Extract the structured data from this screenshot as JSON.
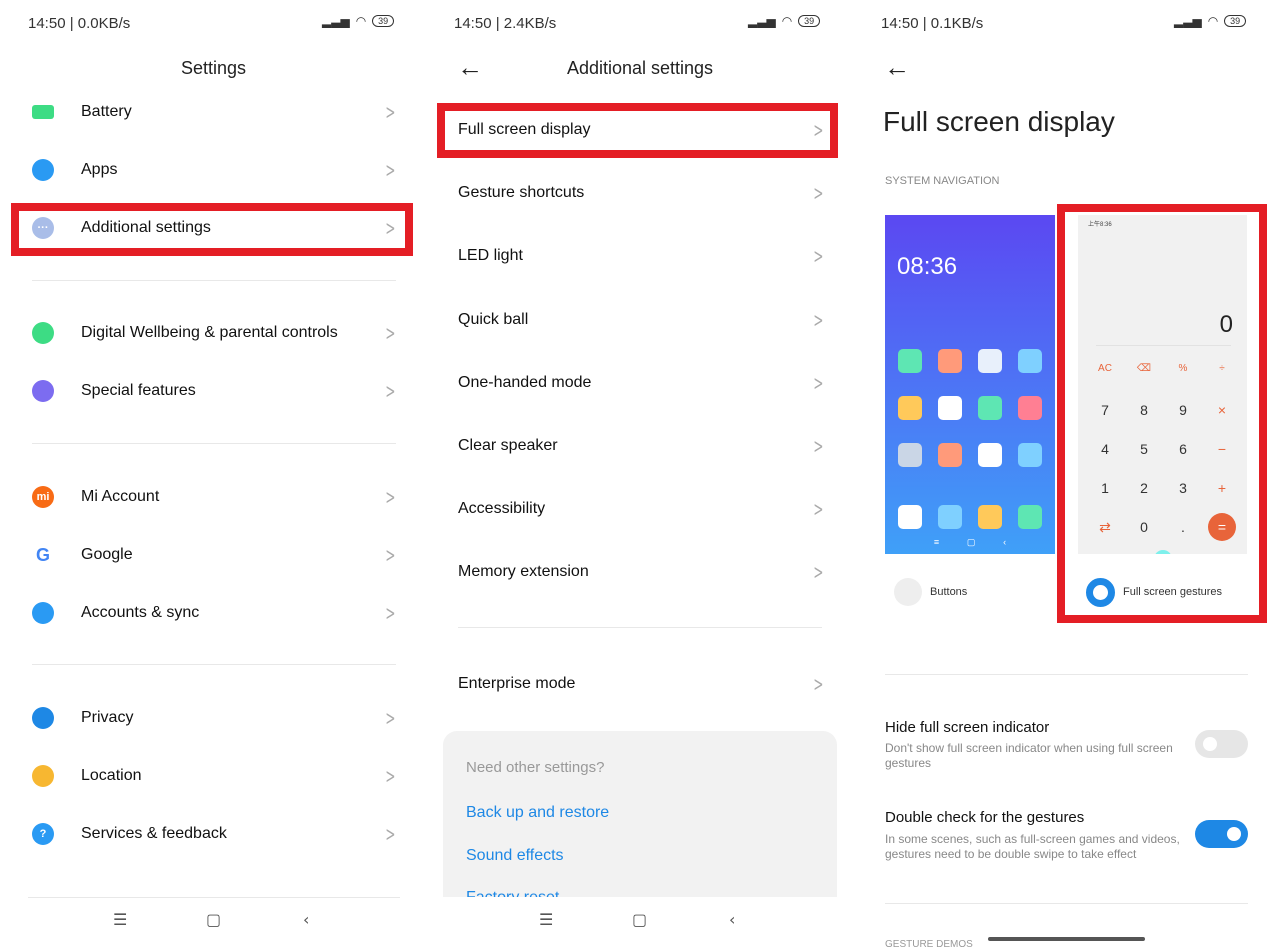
{
  "status_bars": [
    {
      "time": "14:50 | 0.0KB/s",
      "battery": "39"
    },
    {
      "time": "14:50 | 2.4KB/s",
      "battery": "39"
    },
    {
      "time": "14:50 | 0.1KB/s",
      "battery": "39"
    }
  ],
  "settings": {
    "title": "Settings",
    "items": [
      {
        "label": "Battery",
        "icon": "battery-icon",
        "color": "#3ddc84"
      },
      {
        "label": "Apps",
        "icon": "gear-icon",
        "color": "#2a9af3"
      },
      {
        "label": "Additional settings",
        "icon": "more-dots-icon",
        "color": "#a9bde8",
        "highlighted": true
      },
      {
        "label": "Digital Wellbeing & parental controls",
        "icon": "wellbeing-icon",
        "color": "#3ddc84"
      },
      {
        "label": "Special features",
        "icon": "special-features-icon",
        "color": "#7c6cf0"
      },
      {
        "label": "Mi Account",
        "icon": "mi-icon",
        "color": "#f86b15",
        "glyph": "mi"
      },
      {
        "label": "Google",
        "icon": "google-icon",
        "color": "#4285f4",
        "glyph": "G"
      },
      {
        "label": "Accounts & sync",
        "icon": "person-icon",
        "color": "#2a9af3"
      },
      {
        "label": "Privacy",
        "icon": "eye-icon",
        "color": "#1e88e5"
      },
      {
        "label": "Location",
        "icon": "location-pin-icon",
        "color": "#f7b731"
      },
      {
        "label": "Services & feedback",
        "icon": "help-icon",
        "color": "#2a9af3",
        "glyph": "?"
      }
    ]
  },
  "additional": {
    "title": "Additional settings",
    "items": [
      "Full screen display",
      "Gesture shortcuts",
      "LED light",
      "Quick ball",
      "One-handed mode",
      "Clear speaker",
      "Accessibility",
      "Memory extension"
    ],
    "enterprise": "Enterprise mode",
    "card": {
      "heading": "Need other settings?",
      "links": [
        "Back up and restore",
        "Sound effects",
        "Factory reset"
      ]
    }
  },
  "fullscreen": {
    "title": "Full screen display",
    "section": "SYSTEM NAVIGATION",
    "preview_left": {
      "clock": "08:36"
    },
    "preview_right": {
      "time": "上午8:36",
      "display": "0",
      "keys": [
        "AC",
        "⌫",
        "%",
        "÷",
        "7",
        "8",
        "9",
        "×",
        "4",
        "5",
        "6",
        "−",
        "1",
        "2",
        "3",
        "+",
        "⇄",
        "0",
        ".",
        "="
      ]
    },
    "options": [
      {
        "label": "Buttons",
        "selected": false
      },
      {
        "label": "Full screen gestures",
        "selected": true
      }
    ],
    "toggles": [
      {
        "title": "Hide full screen indicator",
        "desc": "Don't show full screen indicator when using full screen gestures",
        "on": false
      },
      {
        "title": "Double check for the gestures",
        "desc": "In some scenes, such as full-screen games and videos, gestures need to be double swipe to take effect",
        "on": true
      }
    ],
    "next_section": "GESTURE DEMOS"
  },
  "nav_icons": [
    "menu-icon",
    "home-icon",
    "back-icon"
  ],
  "nav_glyphs": {
    "menu": "☰",
    "home": "▢",
    "back": "‹"
  },
  "accent": "#1e88e5",
  "highlight": "#e41e25"
}
